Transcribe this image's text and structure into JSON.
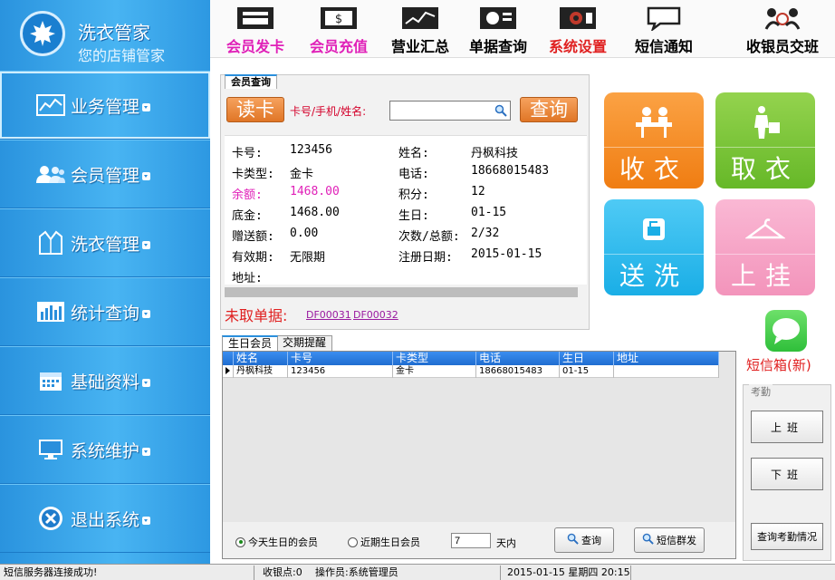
{
  "logo": {
    "title": "洗衣管家",
    "subtitle": "您的店铺管家"
  },
  "sidebar": {
    "items": [
      {
        "label": "业务管理",
        "icon": "chart-line-icon"
      },
      {
        "label": "会员管理",
        "icon": "users-icon"
      },
      {
        "label": "洗衣管理",
        "icon": "shirt-icon"
      },
      {
        "label": "统计查询",
        "icon": "bar-chart-icon"
      },
      {
        "label": "基础资料",
        "icon": "calendar-icon"
      },
      {
        "label": "系统维护",
        "icon": "monitor-icon"
      },
      {
        "label": "退出系统",
        "icon": "close-circle-icon"
      }
    ]
  },
  "toolbar": {
    "items": [
      {
        "label": "会员发卡",
        "color": "#e020b8",
        "icon": "card-icon"
      },
      {
        "label": "会员充值",
        "color": "#e020b8",
        "icon": "cash-icon"
      },
      {
        "label": "营业汇总",
        "color": "#000000",
        "icon": "stock-chart-icon"
      },
      {
        "label": "单据查询",
        "color": "#000000",
        "icon": "document-search-icon"
      },
      {
        "label": "系统设置",
        "color": "#e02020",
        "icon": "settings-screen-icon"
      },
      {
        "label": "短信通知",
        "color": "#000000",
        "icon": "speech-bubble-icon"
      },
      {
        "label": "收银员交班",
        "color": "#000000",
        "icon": "handover-icon"
      }
    ]
  },
  "member": {
    "tab": "会员查询",
    "read_card": "读卡",
    "query_label": "卡号/手机/姓名:",
    "query_value": "",
    "query_button": "查询",
    "card_no_label": "卡号:",
    "card_no": "123456",
    "name_label": "姓名:",
    "name": "丹枫科技",
    "card_type_label": "卡类型:",
    "card_type": "金卡",
    "phone_label": "电话:",
    "phone": "18668015483",
    "balance_label": "余额:",
    "balance": "1468.00",
    "points_label": "积分:",
    "points": "12",
    "base_label": "底金:",
    "base": "1468.00",
    "birthday_label": "生日:",
    "birthday": "01-15",
    "gift_label": "赠送额:",
    "gift": "0.00",
    "count_label": "次数/总额:",
    "count": "2/32",
    "valid_label": "有效期:",
    "valid": "无限期",
    "reg_label": "注册日期:",
    "reg": "2015-01-15",
    "address_label": "地址:",
    "uncollected_label": "未取单据:",
    "uncollected": [
      "DF00031",
      "DF00032"
    ]
  },
  "tiles": [
    {
      "label": "收衣",
      "color": "#f5881f",
      "icon": "receive-clothes-icon"
    },
    {
      "label": "取衣",
      "color": "#7cc43a",
      "icon": "pickup-clothes-icon"
    },
    {
      "label": "送洗",
      "color": "#29b8ee",
      "icon": "send-wash-icon"
    },
    {
      "label": "上挂",
      "color": "#f6a6c8",
      "icon": "hanger-icon"
    }
  ],
  "sms": {
    "label": "短信箱(新)"
  },
  "birthday": {
    "tabs": [
      "生日会员",
      "交期提醒"
    ],
    "columns": [
      "姓名",
      "卡号",
      "卡类型",
      "电话",
      "生日",
      "地址"
    ],
    "rows": [
      [
        "丹枫科技",
        "123456",
        "金卡",
        "18668015483",
        "01-15",
        ""
      ]
    ],
    "radio_today": "今天生日的会员",
    "radio_recent": "近期生日会员",
    "days_value": "7",
    "days_unit": "天内",
    "query_button": "查询",
    "sms_button": "短信群发"
  },
  "attendance": {
    "title": "考勤",
    "on_duty": "上班",
    "off_duty": "下班",
    "query": "查询考勤情况"
  },
  "status": {
    "msg": "短信服务器连接成功!",
    "cashier_point": "收银点:0",
    "operator": "操作员:系统管理员",
    "datetime": "2015-01-15  星期四 20:15"
  }
}
